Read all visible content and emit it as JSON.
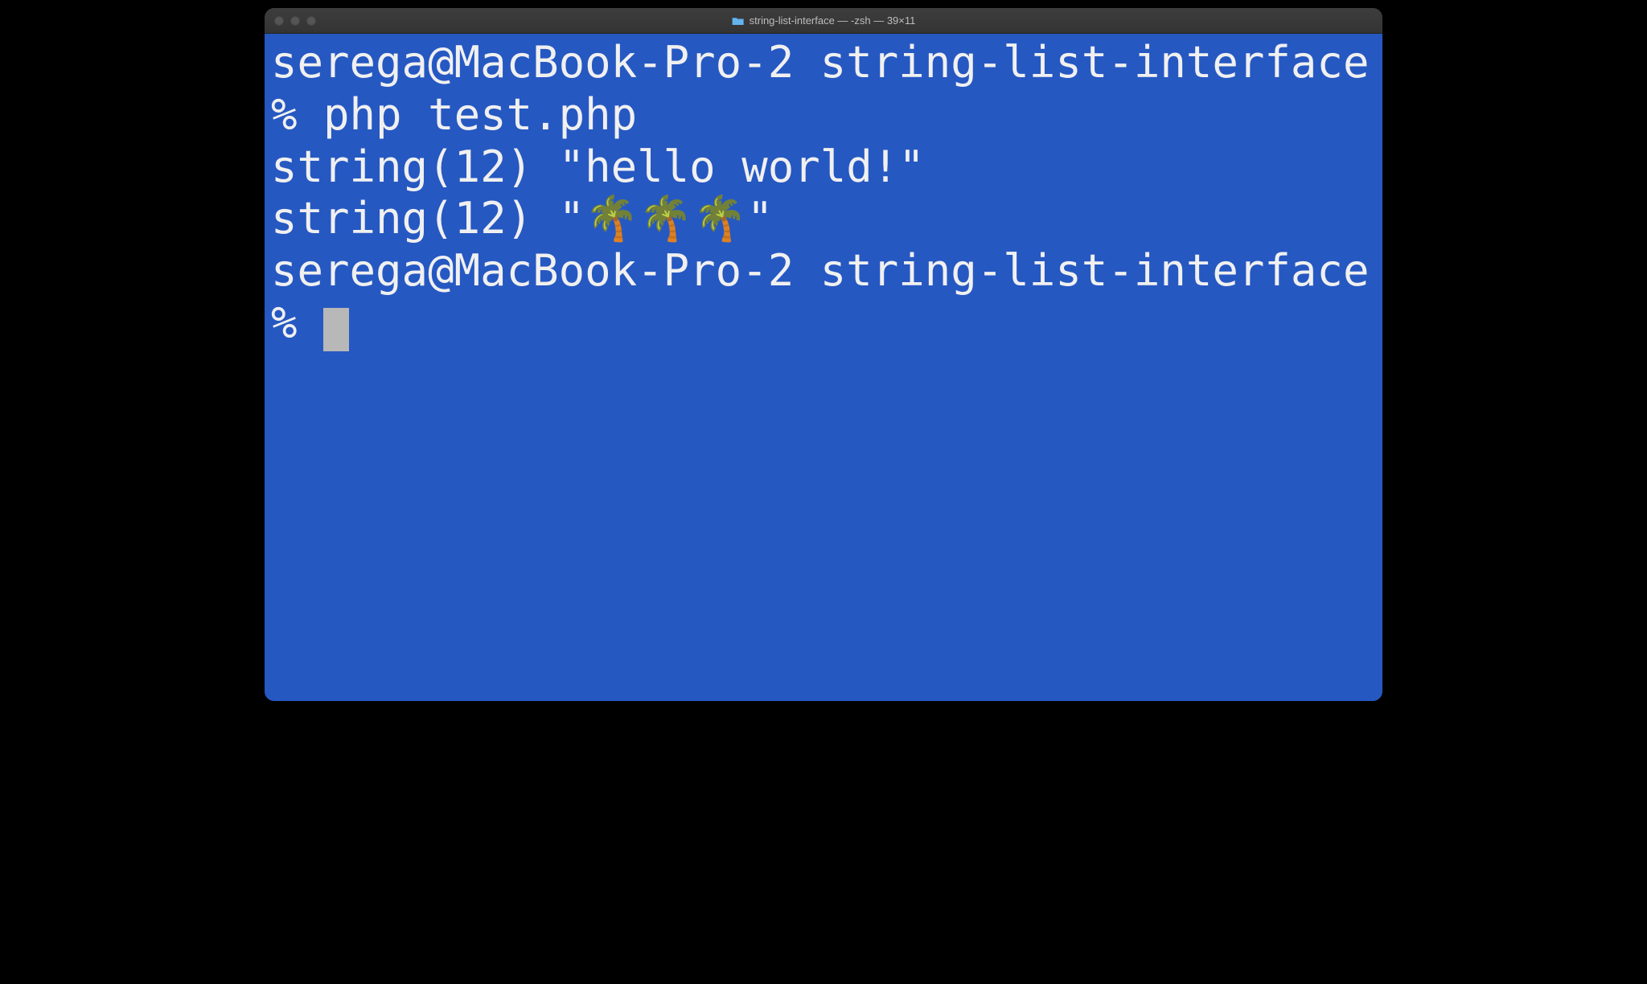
{
  "window": {
    "title": "string-list-interface — -zsh — 39×11"
  },
  "terminal": {
    "lines": [
      "serega@MacBook-Pro-2 string-list-interface % php test.php",
      "string(12) \"hello world!\"",
      "string(12) \"🌴🌴🌴\"",
      "serega@MacBook-Pro-2 string-list-interface % "
    ]
  }
}
